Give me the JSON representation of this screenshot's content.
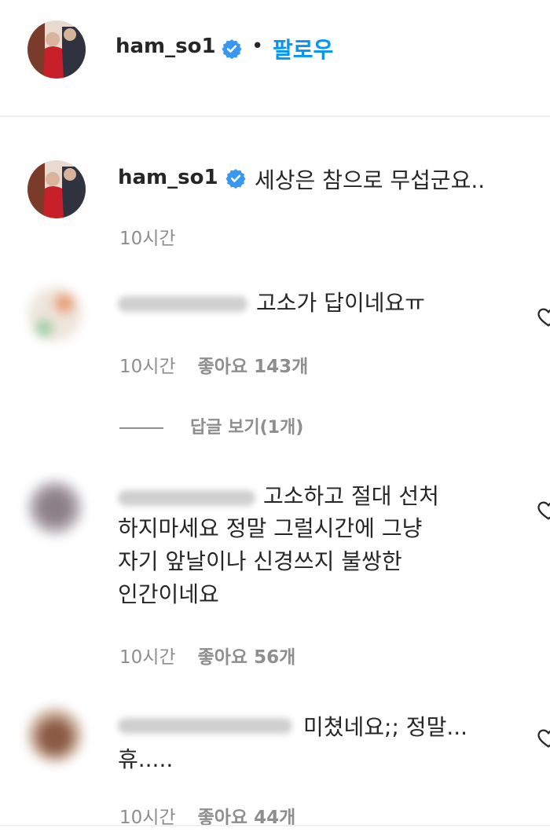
{
  "header": {
    "username": "ham_so1",
    "separator": "•",
    "follow_label": "팔로우"
  },
  "caption": {
    "username": "ham_so1",
    "text": "세상은 참으로 무섭군요..",
    "time": "10시간"
  },
  "comments": [
    {
      "text": "고소가 답이네요ㅠ",
      "time": "10시간",
      "likes": "좋아요 143개",
      "replies": "답글 보기(1개)"
    },
    {
      "text_line1": "고소하고 절대 선처",
      "text_line2": "하지마세요 정말 그럴시간에 그냥",
      "text_line3": "자기 앞날이나 신경쓰지 불쌍한",
      "text_line4": "인간이네요",
      "time": "10시간",
      "likes": "좋아요 56개"
    },
    {
      "text_line1": "미쳤네요;; 정말...",
      "text_line2": "휴.....",
      "time": "10시간",
      "likes": "좋아요 44개"
    }
  ],
  "colors": {
    "accent": "#0095f6",
    "verified": "#3897f0",
    "meta": "#8e8e8e",
    "text": "#262626"
  }
}
